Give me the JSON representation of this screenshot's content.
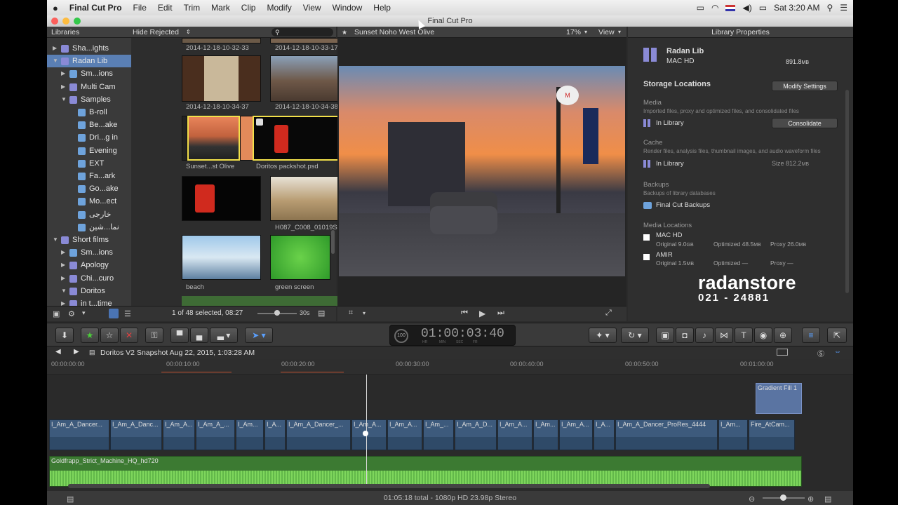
{
  "menubar": {
    "apple": "",
    "app": "Final Cut Pro",
    "items": [
      "File",
      "Edit",
      "Trim",
      "Mark",
      "Clip",
      "Modify",
      "View",
      "Window",
      "Help"
    ],
    "clock": "Sat 3:20 AM"
  },
  "window": {
    "title": "Final Cut Pro"
  },
  "libraries": {
    "header": "Libraries",
    "items": [
      {
        "label": "Sha...ights",
        "level": 0,
        "type": "lib"
      },
      {
        "label": "Radan Lib",
        "level": 0,
        "type": "lib",
        "selected": true
      },
      {
        "label": "Sm...ions",
        "level": 1,
        "type": "folder"
      },
      {
        "label": "Multi Cam",
        "level": 1,
        "type": "event"
      },
      {
        "label": "Samples",
        "level": 1,
        "type": "event"
      },
      {
        "label": "B-roll",
        "level": 2,
        "type": "kw"
      },
      {
        "label": "Be...ake",
        "level": 2,
        "type": "kw"
      },
      {
        "label": "Dri...g in",
        "level": 2,
        "type": "kw"
      },
      {
        "label": "Evening",
        "level": 2,
        "type": "kw"
      },
      {
        "label": "EXT",
        "level": 2,
        "type": "kw"
      },
      {
        "label": "Fa...ark",
        "level": 2,
        "type": "kw"
      },
      {
        "label": "Go...ake",
        "level": 2,
        "type": "kw"
      },
      {
        "label": "Mo...ect",
        "level": 2,
        "type": "kw"
      },
      {
        "label": "خارجی",
        "level": 2,
        "type": "kw"
      },
      {
        "label": "نما...شین",
        "level": 2,
        "type": "kw"
      },
      {
        "label": "Short films",
        "level": 0,
        "type": "lib"
      },
      {
        "label": "Sm...ions",
        "level": 1,
        "type": "folder"
      },
      {
        "label": "Apology",
        "level": 1,
        "type": "event"
      },
      {
        "label": "Chi...curo",
        "level": 1,
        "type": "event"
      },
      {
        "label": "Doritos",
        "level": 1,
        "type": "event"
      },
      {
        "label": "in t...time",
        "level": 1,
        "type": "event"
      }
    ]
  },
  "browser": {
    "filter": "Hide Rejected",
    "clips": [
      {
        "label": "2014-12-18-10-32-33"
      },
      {
        "label": "2014-12-18-10-33-17"
      },
      {
        "label": "2014-12-18-10-34-37"
      },
      {
        "label": "2014-12-18-10-34-38"
      },
      {
        "label": "Sunset...st Olive"
      },
      {
        "label": "Doritos packshot.psd"
      },
      {
        "label": ""
      },
      {
        "label": "H087_C008_01019S"
      },
      {
        "label": "beach"
      },
      {
        "label": "green screen"
      }
    ],
    "status": "1 of 48 selected, 08:27",
    "zoom": "30s"
  },
  "viewer": {
    "title": "Sunset Noho West Olive",
    "zoom": "17%",
    "view": "View"
  },
  "inspector": {
    "header": "Library Properties",
    "lib_name": "Radan Lib",
    "drive": "MAC HD",
    "size": "891.8",
    "size_unit": "MB",
    "storage_title": "Storage Locations",
    "modify_btn": "Modify Settings",
    "media_title": "Media",
    "media_desc": "Imported files, proxy and optimized files, and consolidated files",
    "media_loc": "In Library",
    "consolidate_btn": "Consolidate",
    "cache_title": "Cache",
    "cache_desc": "Render files, analysis files, thumbnail images, and audio waveform files",
    "cache_loc": "In Library",
    "cache_size_label": "Size",
    "cache_size": "812.2",
    "cache_size_unit": "MB",
    "backups_title": "Backups",
    "backups_desc": "Backups of library databases",
    "backups_loc": "Final Cut Backups",
    "media_locations_title": "Media Locations",
    "loc1_name": "MAC HD",
    "loc1_orig_label": "Original",
    "loc1_orig": "9.0",
    "loc1_orig_unit": "GB",
    "loc1_opt_label": "Optimized",
    "loc1_opt": "48.5",
    "loc1_opt_unit": "MB",
    "loc1_proxy_label": "Proxy",
    "loc1_proxy": "26.0",
    "loc1_proxy_unit": "MB",
    "loc2_name": "AMIR",
    "loc2_orig_label": "Original",
    "loc2_orig": "1.5",
    "loc2_orig_unit": "MB",
    "loc2_opt_label": "Optimized",
    "loc2_opt": "—",
    "loc2_proxy_label": "Proxy",
    "loc2_proxy": "—"
  },
  "watermark": {
    "brand": "radanstore",
    "phone": "021 - 24881"
  },
  "toolbar": {
    "timecode": "01:00:03:40",
    "timecode_labels": [
      "HR",
      "MIN",
      "SEC",
      "FR"
    ],
    "speed": "100"
  },
  "timeline": {
    "project": "Doritos V2 Snapshot Aug 22, 2015, 1:03:28 AM",
    "ruler": [
      "00:00:00:00",
      "00:00:10:00",
      "00:00:20:00",
      "00:00:30:00",
      "00:00:40:00",
      "00:00:50:00",
      "00:01:00:00"
    ],
    "title_clip": "Gradient Fill 1",
    "clips": [
      "I_Am_A_Dancer...",
      "I_Am_A_Danc...",
      "I_Am_A...",
      "I_Am_A_...",
      "I_Am...",
      "I_A...",
      "I_Am_A_Dancer_...",
      "I_Am_A...",
      "I_Am_A...",
      "I_Am_...",
      "I_Am_A_D...",
      "I_Am_A...",
      "I_Am...",
      "I_Am_A...",
      "I_A...",
      "I_Am_A_Dancer_ProRes_4444",
      "I_Am...",
      "Fire_AtCam..."
    ],
    "audio_clip": "Goldfrapp_Strict_Machine_HQ_hd720"
  },
  "status": {
    "text": "01:05:18 total - 1080p HD 23.98p Stereo"
  },
  "colors": {
    "accent": "#5a7fb4",
    "audio": "#5aa84a",
    "video": "#3d5a7c"
  }
}
